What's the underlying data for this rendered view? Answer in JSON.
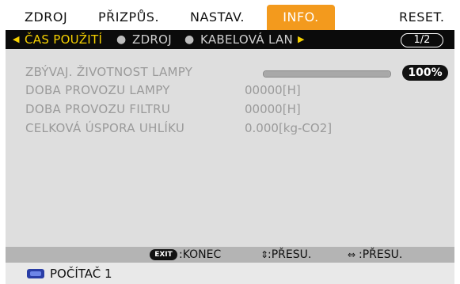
{
  "menu": {
    "tabs": [
      {
        "label": "ZDROJ"
      },
      {
        "label": "PŘIZPŮS."
      },
      {
        "label": "NASTAV."
      },
      {
        "label": "INFO."
      },
      {
        "label": "RESET."
      }
    ],
    "active_tab": "INFO.",
    "accent_color": "#f39a1d"
  },
  "subnav": {
    "items": [
      {
        "label": "ČAS POUŽITÍ"
      },
      {
        "label": "ZDROJ"
      },
      {
        "label": "KABELOVÁ LAN"
      }
    ],
    "active_item": "ČAS POUŽITÍ",
    "left_arrow_icon": "triangle-left-icon",
    "right_arrow_icon": "triangle-right-icon",
    "page": "1/2",
    "highlight_color": "#f5d000"
  },
  "info": {
    "lamp_life_label": "ZBÝVAJ. ŽIVOTNOST LAMPY",
    "lamp_life_percent": "100%",
    "lamp_life_fraction": 1.0,
    "lamp_hours_label": "DOBA PROVOZU LAMPY",
    "lamp_hours_value": "00000[H]",
    "filter_hours_label": "DOBA PROVOZU FILTRU",
    "filter_hours_value": "00000[H]",
    "carbon_label": "CELKOVÁ ÚSPORA UHLÍKU",
    "carbon_value": "0.000[kg-CO2]"
  },
  "help": {
    "exit_key": "EXIT",
    "exit_label": ":KONEC",
    "move_updown_icon": "up-down-arrow-icon",
    "move_updown_label": ":PŘESU.",
    "move_leftright_icon": "left-right-arrow-icon",
    "move_leftright_label": ":PŘESU."
  },
  "footer": {
    "source_icon": "computer-input-icon",
    "source_label": "POČÍTAČ 1"
  }
}
